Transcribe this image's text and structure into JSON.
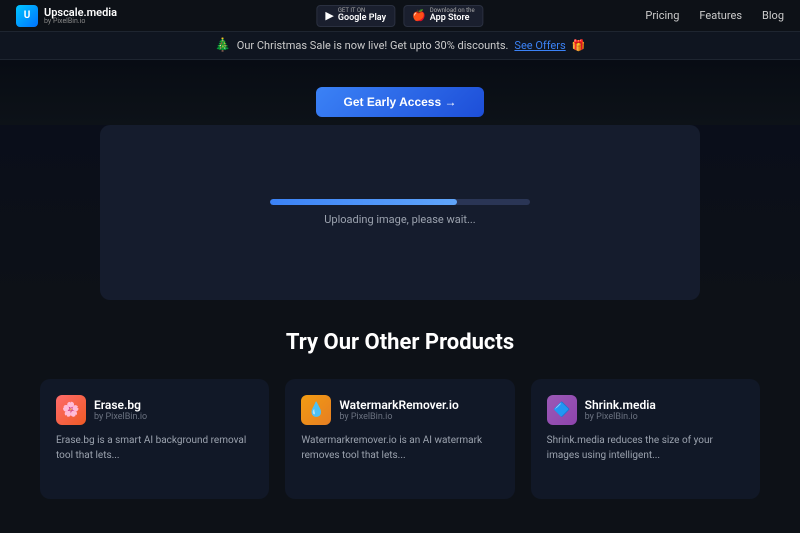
{
  "header": {
    "logo_name": "Upscale.media",
    "logo_sub": "by PixelBin.io",
    "google_play_small": "GET IT ON",
    "google_play_name": "Google Play",
    "app_store_small": "Download on the",
    "app_store_name": "App Store",
    "nav": [
      "Pricing",
      "Features",
      "Blog"
    ]
  },
  "promo": {
    "text": "🎄 Our Christmas Sale is now live! Get upto 30% discounts.",
    "link_text": "See Offers",
    "emoji": "🎁"
  },
  "hero": {
    "button_label": "Get Early Access →"
  },
  "upload": {
    "progress_percent": 72,
    "progress_text": "Uploading image, please wait...",
    "progress_width": "72%"
  },
  "products": {
    "section_title": "Try Our Other Products",
    "items": [
      {
        "name": "Erase.bg",
        "sub": "by PixelBin.io",
        "icon": "🌸",
        "color_class": "product-logo-erasebg",
        "desc": "Erase.bg is a smart AI background removal tool that lets..."
      },
      {
        "name": "WatermarkRemover.io",
        "sub": "by PixelBin.io",
        "icon": "💧",
        "color_class": "product-logo-watermark",
        "desc": "Watermarkremover.io is an AI watermark removes tool that lets..."
      },
      {
        "name": "Shrink.media",
        "sub": "by PixelBin.io",
        "icon": "🔷",
        "color_class": "product-logo-shrink",
        "desc": "Shrink.media reduces the size of your images using intelligent..."
      }
    ]
  }
}
